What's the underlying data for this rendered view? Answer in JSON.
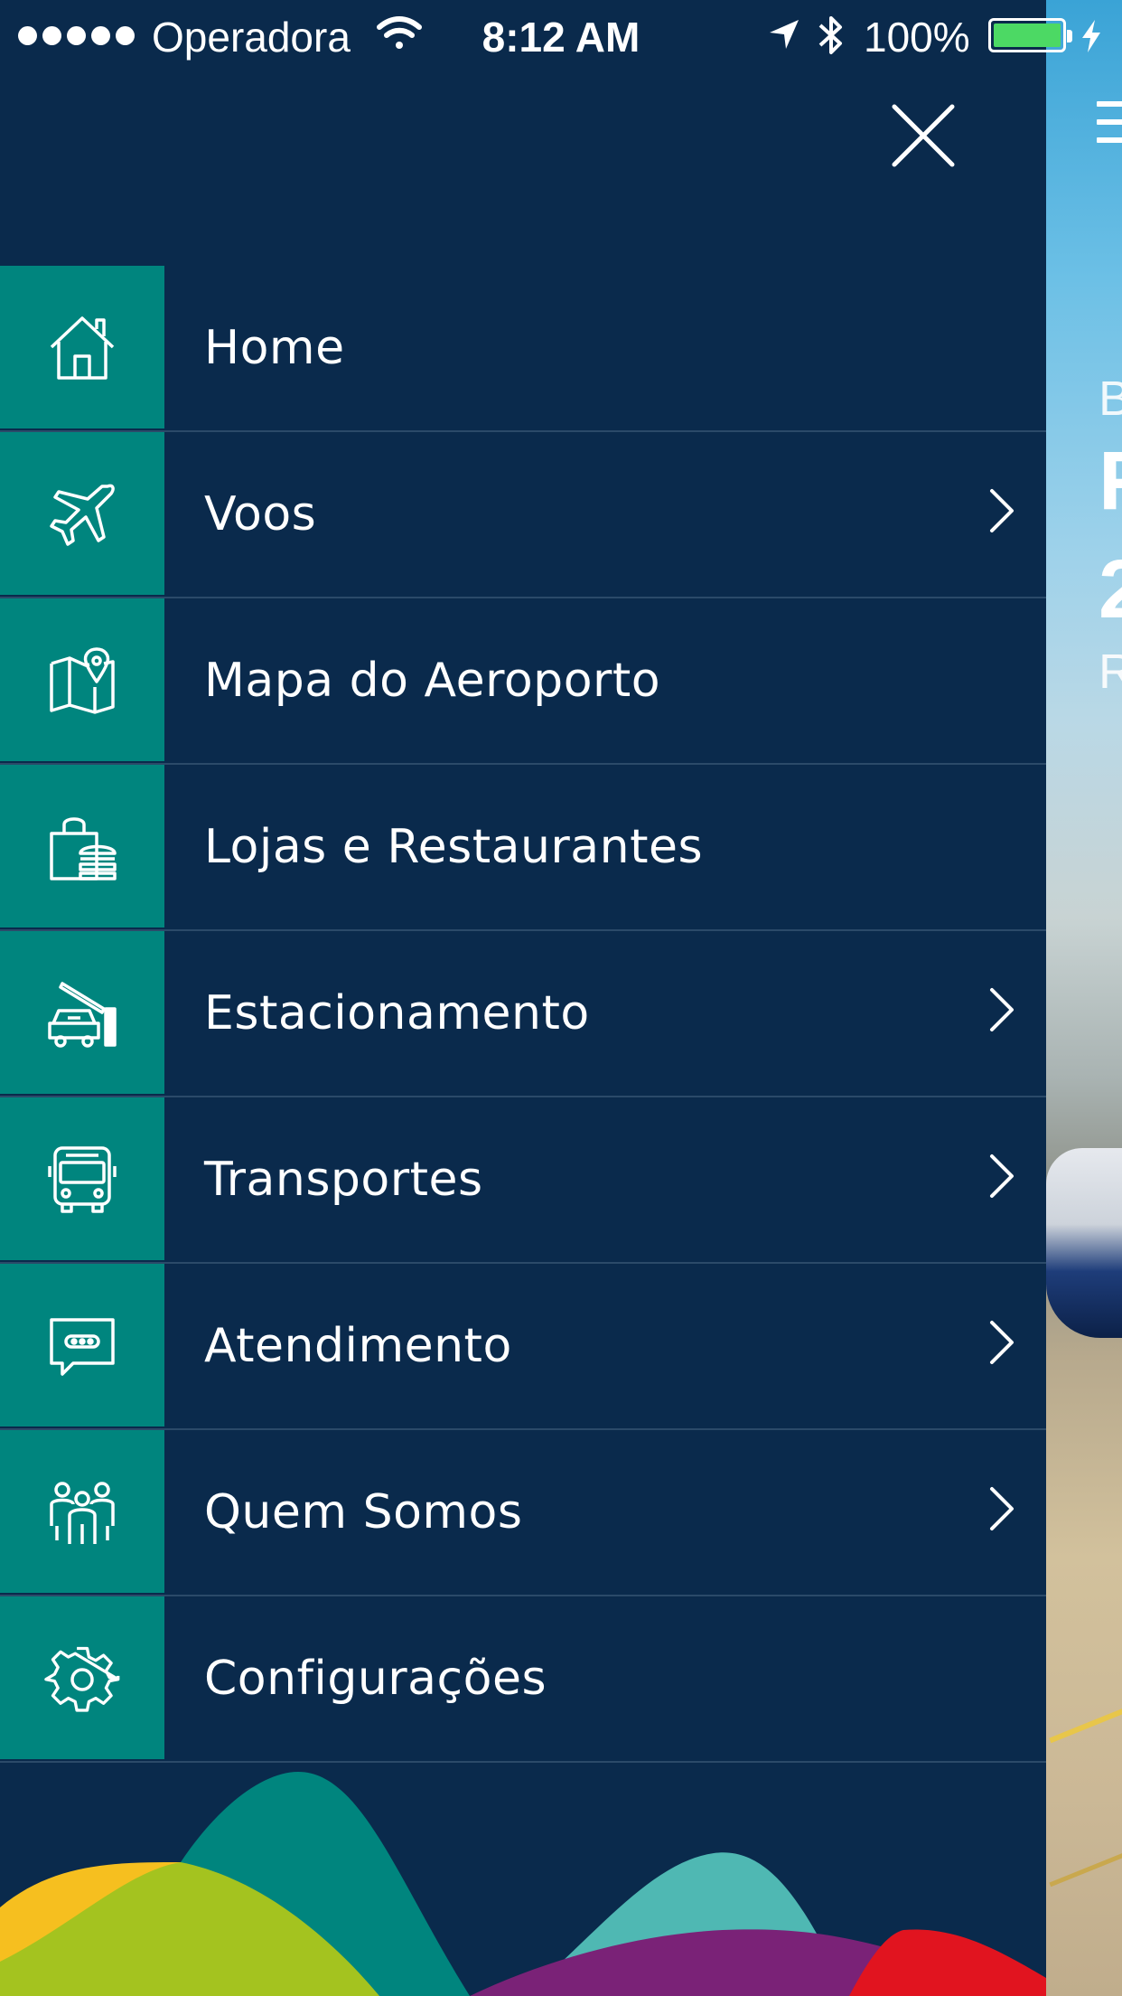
{
  "status_bar": {
    "carrier": "Operadora",
    "time": "8:12 AM",
    "battery": "100%"
  },
  "menu": {
    "items": [
      {
        "label": "Home",
        "icon": "home-icon",
        "has_chevron": false
      },
      {
        "label": "Voos",
        "icon": "airplane-icon",
        "has_chevron": true
      },
      {
        "label": "Mapa do Aeroporto",
        "icon": "map-pin-icon",
        "has_chevron": false
      },
      {
        "label": "Lojas e Restaurantes",
        "icon": "shopping-bag-burger-icon",
        "has_chevron": false
      },
      {
        "label": "Estacionamento",
        "icon": "parking-car-icon",
        "has_chevron": true
      },
      {
        "label": "Transportes",
        "icon": "bus-icon",
        "has_chevron": true
      },
      {
        "label": "Atendimento",
        "icon": "chat-bubble-icon",
        "has_chevron": true
      },
      {
        "label": "Quem Somos",
        "icon": "people-icon",
        "has_chevron": true
      },
      {
        "label": "Configurações",
        "icon": "gear-icon",
        "has_chevron": false
      }
    ]
  },
  "colors": {
    "drawer_bg": "#0a2a4c",
    "icon_cell": "#00857e",
    "divider": "#2b4a69",
    "wave_yellow": "#f6bf1f",
    "wave_green": "#a4c31f",
    "wave_teal": "#00857e",
    "wave_light_teal": "#4fb8b3",
    "wave_purple": "#7a2277",
    "wave_red": "#e1141f"
  }
}
